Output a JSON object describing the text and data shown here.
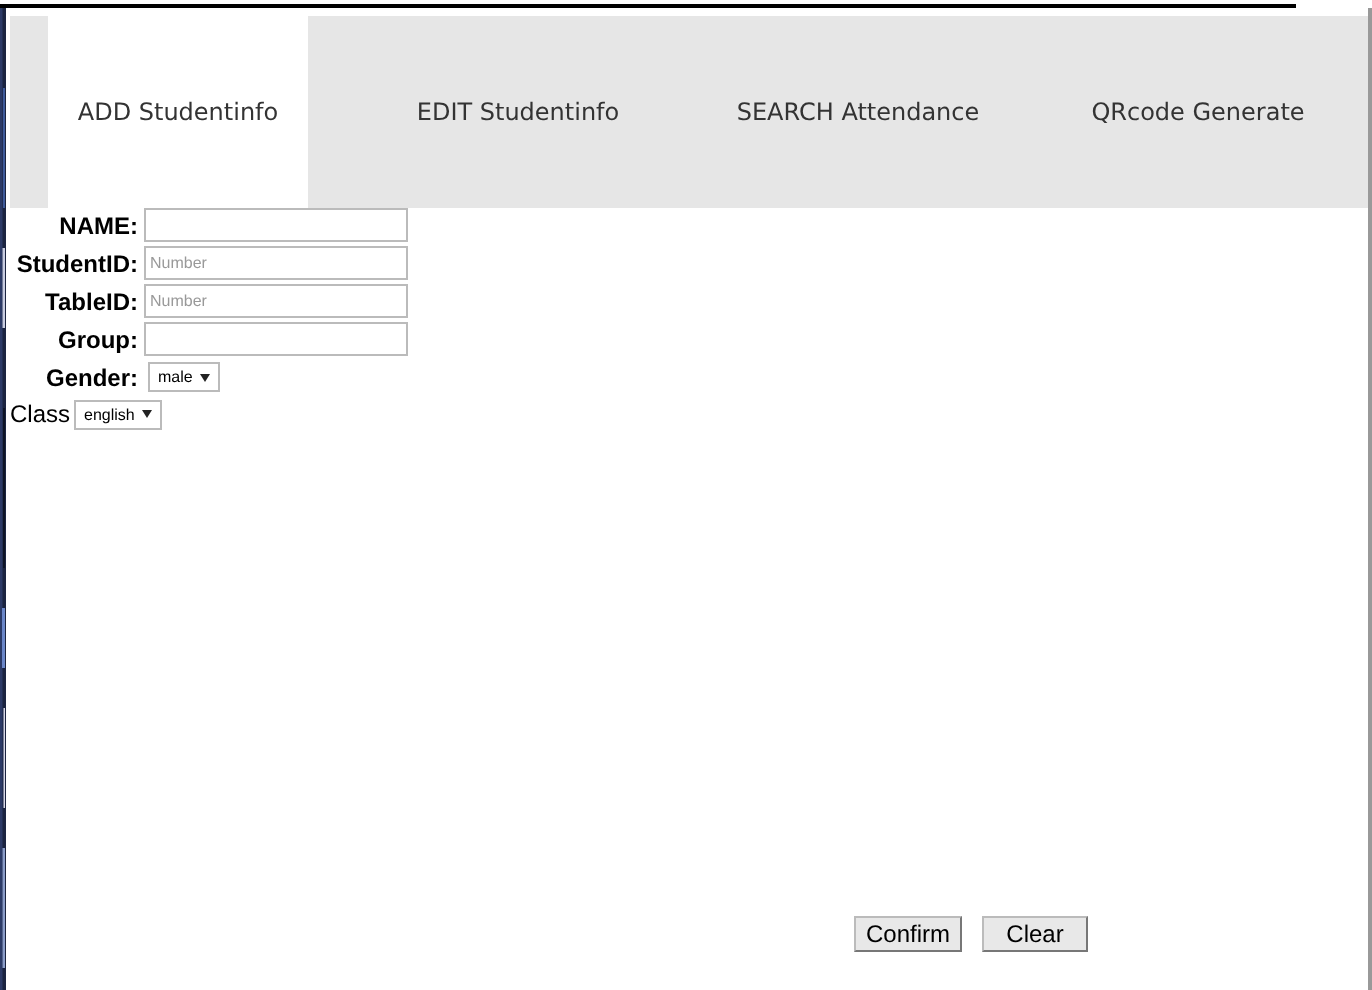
{
  "tabs": [
    {
      "label": "ADD Studentinfo",
      "selected": true
    },
    {
      "label": "EDIT Studentinfo",
      "selected": false
    },
    {
      "label": "SEARCH Attendance",
      "selected": false
    },
    {
      "label": "QRcode Generate",
      "selected": false
    }
  ],
  "form": {
    "fields": [
      {
        "kind": "text",
        "label": "NAME:"
      },
      {
        "kind": "text",
        "label": "StudentID:",
        "placeholder": "Number"
      },
      {
        "kind": "text",
        "label": "TableID:",
        "placeholder": "Number"
      },
      {
        "kind": "text",
        "label": "Group:"
      },
      {
        "kind": "select",
        "label": "Gender:",
        "value": "male"
      }
    ],
    "class_field": {
      "label": "Class",
      "value": "english"
    }
  },
  "buttons": [
    "Confirm",
    "Clear"
  ]
}
